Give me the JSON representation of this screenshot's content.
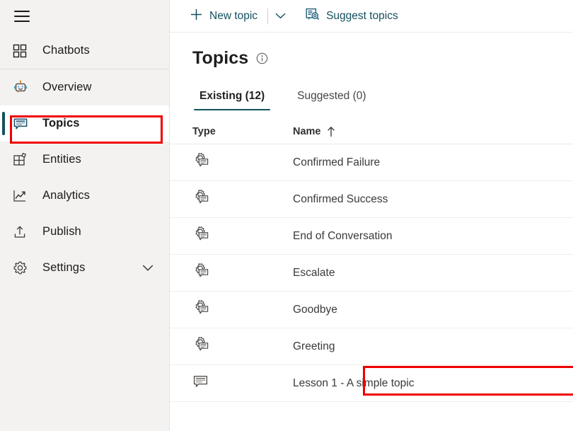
{
  "sidebar": {
    "menu_icon": "hamburger-icon",
    "items": [
      {
        "label": "Chatbots",
        "icon": "grid-apps-icon",
        "selected": false,
        "divider_after": true,
        "chevron": false
      },
      {
        "label": "Overview",
        "icon": "bot-icon",
        "selected": false,
        "divider_after": false,
        "chevron": false
      },
      {
        "label": "Topics",
        "icon": "speech-bubble-icon",
        "selected": true,
        "divider_after": false,
        "chevron": false
      },
      {
        "label": "Entities",
        "icon": "entities-icon",
        "selected": false,
        "divider_after": false,
        "chevron": false
      },
      {
        "label": "Analytics",
        "icon": "line-chart-icon",
        "selected": false,
        "divider_after": false,
        "chevron": false
      },
      {
        "label": "Publish",
        "icon": "upload-icon",
        "selected": false,
        "divider_after": false,
        "chevron": false
      },
      {
        "label": "Settings",
        "icon": "gear-icon",
        "selected": false,
        "divider_after": false,
        "chevron": true
      }
    ]
  },
  "command_bar": {
    "new_topic_label": "New topic",
    "new_topic_icon": "plus-icon",
    "new_topic_caret_icon": "chevron-down-icon",
    "suggest_topics_label": "Suggest topics",
    "suggest_topics_icon": "document-search-icon"
  },
  "page": {
    "title": "Topics",
    "info_icon": "info-icon"
  },
  "tabs": [
    {
      "label": "Existing (12)",
      "active": true
    },
    {
      "label": "Suggested (0)",
      "active": false
    }
  ],
  "table": {
    "columns": [
      {
        "label": "Type",
        "sorted": false
      },
      {
        "label": "Name",
        "sorted": true,
        "sort_icon": "arrow-up-icon",
        "sort_direction": "ascending"
      }
    ],
    "rows": [
      {
        "icon": "system-topic-icon",
        "name": "Confirmed Failure",
        "highlighted": false
      },
      {
        "icon": "system-topic-icon",
        "name": "Confirmed Success",
        "highlighted": false
      },
      {
        "icon": "system-topic-icon",
        "name": "End of Conversation",
        "highlighted": false
      },
      {
        "icon": "system-topic-icon",
        "name": "Escalate",
        "highlighted": false
      },
      {
        "icon": "system-topic-icon",
        "name": "Goodbye",
        "highlighted": false
      },
      {
        "icon": "system-topic-icon",
        "name": "Greeting",
        "highlighted": true
      },
      {
        "icon": "custom-topic-icon",
        "name": "Lesson 1 - A simple topic",
        "highlighted": false
      }
    ]
  },
  "annotations": [
    {
      "name": "topics-nav-highlight",
      "color": "#ef0000"
    },
    {
      "name": "greeting-row-highlight",
      "color": "#ef0000"
    }
  ],
  "colors": {
    "accent": "#14505e",
    "sidebar_bg": "#f3f2f1",
    "annotation": "#ef0000"
  }
}
